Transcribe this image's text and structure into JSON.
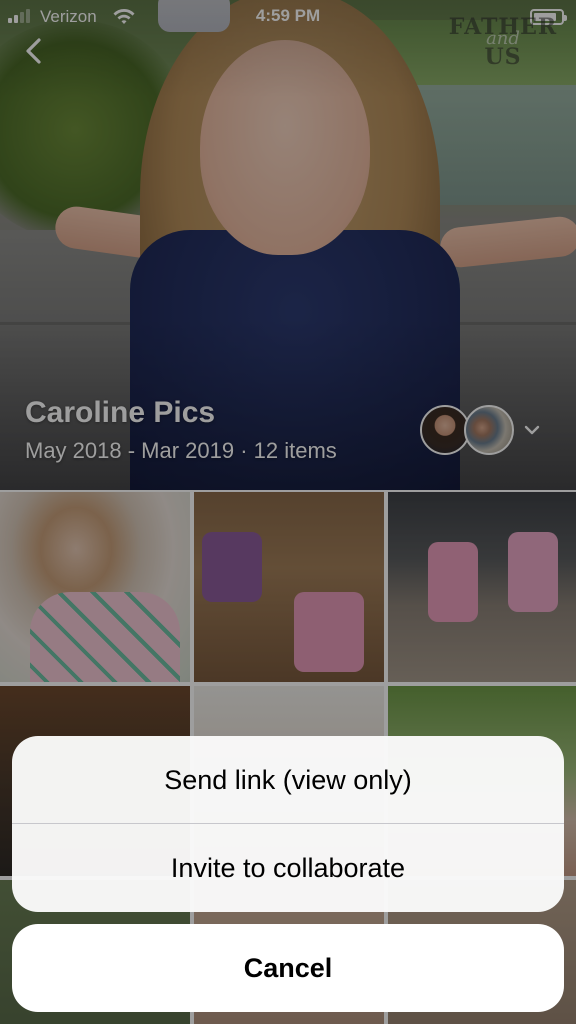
{
  "status_bar": {
    "carrier": "Verizon",
    "time": "4:59 PM",
    "signal_bars_filled": 2,
    "signal_bars_total": 4,
    "battery_level": 0.85
  },
  "watermark": {
    "line1": "FATHER",
    "line2": "and",
    "line3": "US"
  },
  "album": {
    "title": "Caroline Pics",
    "meta": "May 2018 - Mar 2019 · 12 items"
  },
  "icons": {
    "back": "chevron-left-icon",
    "members": "chevron-down-icon",
    "wifi": "wifi-icon",
    "signal": "signal-icon",
    "battery": "battery-icon"
  },
  "action_sheet": {
    "send_link": "Send link (view only)",
    "invite": "Invite to collaborate",
    "cancel": "Cancel"
  },
  "colors": {
    "sheet_background": "#fafafa",
    "divider": "#c7c7cc",
    "text": "#000000"
  }
}
